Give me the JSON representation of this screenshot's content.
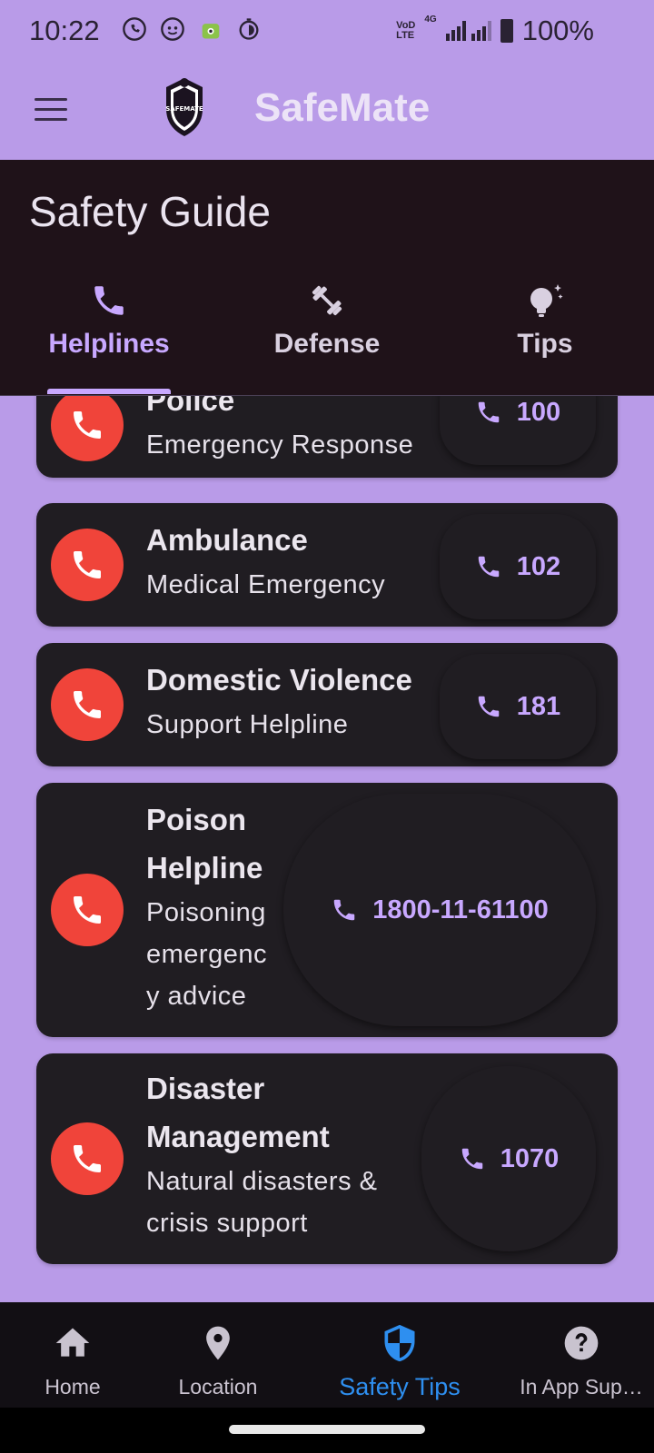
{
  "status_bar": {
    "time": "10:22",
    "battery": "100%",
    "network_label_top": "VoD",
    "network_label_bottom": "LTE",
    "network_type": "4G",
    "icons": [
      "whatsapp-icon",
      "messenger-icon",
      "android-icon",
      "timer-icon",
      "signal-icon",
      "battery-icon"
    ]
  },
  "app_bar": {
    "title": "SafeMate",
    "logo_text": "SAFEMATE"
  },
  "header": {
    "title": "Safety Guide",
    "tabs": [
      {
        "label": "Helplines",
        "icon": "phone-icon",
        "active": true
      },
      {
        "label": "Defense",
        "icon": "dumbbell-icon",
        "active": false
      },
      {
        "label": "Tips",
        "icon": "lightbulb-icon",
        "active": false
      }
    ]
  },
  "helplines": [
    {
      "title": "Police",
      "subtitle": "Emergency Response",
      "number": "100"
    },
    {
      "title": "Ambulance",
      "subtitle": "Medical Emergency",
      "number": "102"
    },
    {
      "title": "Domestic Violence",
      "subtitle": "Support Helpline",
      "number": "181"
    },
    {
      "title_lines": [
        "Poison",
        "Helpline"
      ],
      "subtitle_lines": [
        "Poisoning",
        "emergenc",
        "y advice"
      ],
      "number": "1800-11-61100"
    },
    {
      "title_lines": [
        "Disaster",
        "Management"
      ],
      "subtitle_lines": [
        "Natural disasters &",
        "crisis support"
      ],
      "number": "1070"
    }
  ],
  "bottom_nav": [
    {
      "label": "Home",
      "icon": "home-icon",
      "active": false
    },
    {
      "label": "Location",
      "icon": "location-pin-icon",
      "active": false
    },
    {
      "label": "Safety Tips",
      "icon": "shield-icon",
      "active": true
    },
    {
      "label": "In App Sup…",
      "icon": "help-icon",
      "active": false
    }
  ],
  "colors": {
    "background": "#b99be8",
    "header": "#1f1219",
    "card": "#201d22",
    "call_avatar": "#f0443a",
    "accent": "#c8a8ff",
    "nav_active": "#2e8ff0"
  }
}
